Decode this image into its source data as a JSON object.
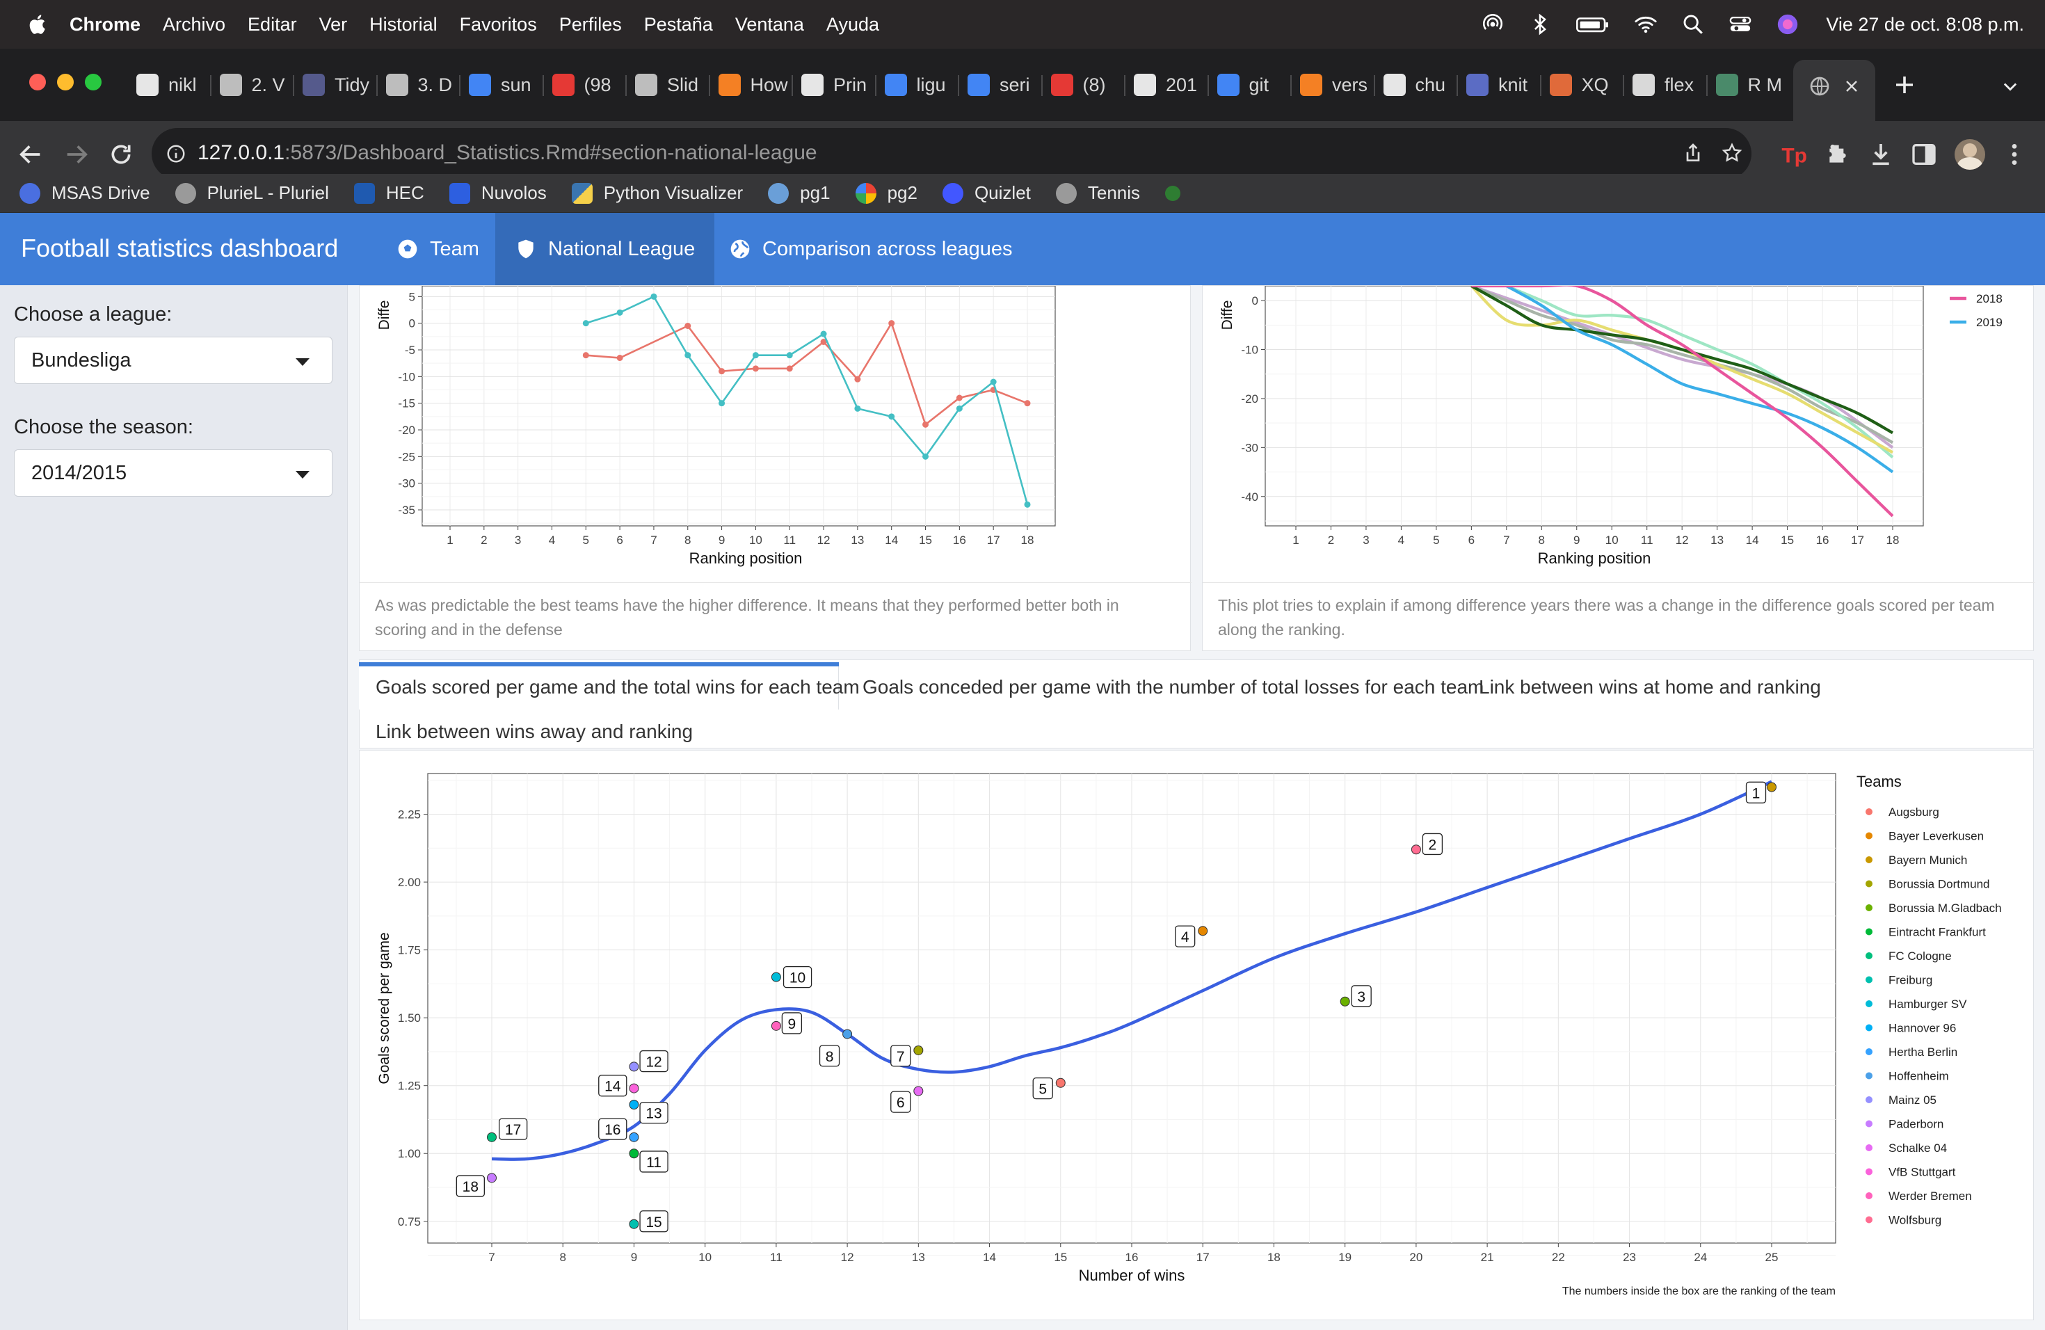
{
  "menubar": {
    "app": "Chrome",
    "items": [
      "Archivo",
      "Editar",
      "Ver",
      "Historial",
      "Favoritos",
      "Perfiles",
      "Pestaña",
      "Ventana",
      "Ayuda"
    ],
    "clock": "Vie 27 de oct.  8:08 p.m."
  },
  "tabs": [
    {
      "label": "nikl",
      "color": "#e6e6e6"
    },
    {
      "label": "2. V",
      "color": "#bdbdbd"
    },
    {
      "label": "Tidy",
      "color": "#555a8c"
    },
    {
      "label": "3. D",
      "color": "#bdbdbd"
    },
    {
      "label": "sun",
      "color": "#4285f4"
    },
    {
      "label": "(98",
      "color": "#e53935"
    },
    {
      "label": "Slid",
      "color": "#bdbdbd"
    },
    {
      "label": "How",
      "color": "#f48024"
    },
    {
      "label": "Prin",
      "color": "#e6e6e6"
    },
    {
      "label": "ligu",
      "color": "#4285f4"
    },
    {
      "label": "seri",
      "color": "#4285f4"
    },
    {
      "label": "(8)",
      "color": "#e53935"
    },
    {
      "label": "201",
      "color": "#e6e6e6"
    },
    {
      "label": "git",
      "color": "#4285f4"
    },
    {
      "label": "vers",
      "color": "#f48024"
    },
    {
      "label": "chu",
      "color": "#e6e6e6"
    },
    {
      "label": "knit",
      "color": "#5b6cc4"
    },
    {
      "label": "XQ",
      "color": "#e06a3a"
    },
    {
      "label": "flex",
      "color": "#d9d9d9"
    },
    {
      "label": "R M",
      "color": "#4a8a6a"
    }
  ],
  "address": {
    "host": "127.0.0.1",
    "path": ":5873/Dashboard_Statistics.Rmd#section-national-league"
  },
  "bookmarks": [
    "MSAS Drive",
    "PlurieL - Pluriel",
    "HEC",
    "Nuvolos",
    "Python Visualizer",
    "pg1",
    "pg2",
    "Quizlet",
    "Tennis"
  ],
  "app": {
    "brand": "Football statistics dashboard",
    "nav": [
      "Team",
      "National League",
      "Comparison across leagues"
    ]
  },
  "sidebar": {
    "league_label": "Choose a league:",
    "league_value": "Bundesliga",
    "season_label": "Choose the season:",
    "season_value": "2014/2015"
  },
  "panels": {
    "left_caption": "As was predictable the best teams have the higher difference. It means that they performed better both in scoring and in the defense",
    "right_caption": "This plot tries to explain if among difference years there was a change in the difference goals scored per team along the ranking."
  },
  "tabset": [
    "Goals scored per game and the total wins for each team",
    "Goals conceded per game with the number of total losses for each team",
    "Link between wins at home and ranking",
    "Link between wins away and ranking"
  ],
  "chart_data": [
    {
      "type": "line",
      "xlabel": "Ranking position",
      "ylabel": "Diffe",
      "x": [
        1,
        2,
        3,
        4,
        5,
        6,
        7,
        8,
        9,
        10,
        11,
        12,
        13,
        14,
        15,
        16,
        17,
        18
      ],
      "yticks": [
        5,
        0,
        -5,
        -10,
        -15,
        -20,
        -25,
        -30,
        -35
      ],
      "ylim": [
        -38,
        7
      ],
      "colors": [
        "#e8756b",
        "#44bfc4"
      ],
      "series": [
        {
          "name": "",
          "points": [
            [
              5,
              -6
            ],
            [
              6,
              -6.5
            ],
            [
              8,
              -0.5
            ],
            [
              9,
              -9
            ],
            [
              10,
              -8.5
            ],
            [
              11,
              -8.5
            ],
            [
              12,
              -3.5
            ],
            [
              13,
              -10.5
            ],
            [
              14,
              0
            ],
            [
              15,
              -19
            ],
            [
              16,
              -14
            ],
            [
              17,
              -12.5
            ],
            [
              18,
              -15
            ]
          ]
        },
        {
          "name": "",
          "points": [
            [
              5,
              0
            ],
            [
              6,
              2
            ],
            [
              7,
              5
            ],
            [
              8,
              -6
            ],
            [
              9,
              -15
            ],
            [
              10,
              -6
            ],
            [
              11,
              -6
            ],
            [
              12,
              -2
            ],
            [
              13,
              -16
            ],
            [
              14,
              -17.5
            ],
            [
              15,
              -25
            ],
            [
              16,
              -16
            ],
            [
              17,
              -11
            ],
            [
              18,
              -34
            ]
          ]
        }
      ]
    },
    {
      "type": "line",
      "xlabel": "Ranking position",
      "ylabel": "Diffe",
      "x": [
        1,
        2,
        3,
        4,
        5,
        6,
        7,
        8,
        9,
        10,
        11,
        12,
        13,
        14,
        15,
        16,
        17,
        18
      ],
      "yticks": [
        0,
        -10,
        -20,
        -30,
        -40
      ],
      "ylim": [
        -46,
        3
      ],
      "legend": [
        {
          "name": "2018",
          "color": "#e8559c"
        },
        {
          "name": "2019",
          "color": "#3aaee8"
        }
      ],
      "series": [
        {
          "color": "#e8559c",
          "points": [
            [
              6,
              3
            ],
            [
              8,
              3
            ],
            [
              9,
              3
            ],
            [
              10,
              0
            ],
            [
              11,
              -5
            ],
            [
              12,
              -9
            ],
            [
              13,
              -14
            ],
            [
              14,
              -19
            ],
            [
              15,
              -24
            ],
            [
              16,
              -30
            ],
            [
              17,
              -37
            ],
            [
              18,
              -44
            ]
          ]
        },
        {
          "color": "#3aaee8",
          "points": [
            [
              7,
              3
            ],
            [
              8,
              -1
            ],
            [
              9,
              -6
            ],
            [
              10,
              -9
            ],
            [
              11,
              -13
            ],
            [
              12,
              -17
            ],
            [
              13,
              -19
            ],
            [
              14,
              -21
            ],
            [
              15,
              -23
            ],
            [
              16,
              -26
            ],
            [
              17,
              -30
            ],
            [
              18,
              -35
            ]
          ]
        },
        {
          "color": "#1f5e16",
          "points": [
            [
              6,
              3
            ],
            [
              7,
              -1
            ],
            [
              8,
              -5
            ],
            [
              9,
              -6
            ],
            [
              10,
              -7
            ],
            [
              11,
              -8
            ],
            [
              12,
              -10
            ],
            [
              13,
              -12
            ],
            [
              14,
              -14
            ],
            [
              15,
              -17
            ],
            [
              16,
              -20
            ],
            [
              17,
              -23
            ],
            [
              18,
              -27
            ]
          ]
        },
        {
          "color": "#e6dd70",
          "points": [
            [
              6,
              3
            ],
            [
              7,
              -4
            ],
            [
              8,
              -5
            ],
            [
              9,
              -4
            ],
            [
              10,
              -6
            ],
            [
              11,
              -8
            ],
            [
              12,
              -10
            ],
            [
              13,
              -13
            ],
            [
              14,
              -16
            ],
            [
              15,
              -19
            ],
            [
              16,
              -23
            ],
            [
              17,
              -27
            ],
            [
              18,
              -31
            ]
          ]
        },
        {
          "color": "#9ee6c4",
          "points": [
            [
              7,
              3
            ],
            [
              8,
              0
            ],
            [
              9,
              -3
            ],
            [
              10,
              -3
            ],
            [
              11,
              -4
            ],
            [
              12,
              -7
            ],
            [
              13,
              -10
            ],
            [
              14,
              -13
            ],
            [
              15,
              -17
            ],
            [
              16,
              -21
            ],
            [
              17,
              -26
            ],
            [
              18,
              -32
            ]
          ]
        },
        {
          "color": "#a8b4a8",
          "points": [
            [
              6,
              3
            ],
            [
              7,
              0
            ],
            [
              8,
              -3
            ],
            [
              9,
              -5
            ],
            [
              10,
              -8
            ],
            [
              11,
              -9
            ],
            [
              12,
              -11
            ],
            [
              13,
              -13
            ],
            [
              14,
              -15
            ],
            [
              15,
              -18
            ],
            [
              16,
              -22
            ],
            [
              17,
              -25
            ],
            [
              18,
              -29
            ]
          ]
        },
        {
          "color": "#c8a8d0",
          "points": [
            [
              6,
              3
            ],
            [
              8,
              -2
            ],
            [
              10,
              -7
            ],
            [
              12,
              -12
            ],
            [
              14,
              -15
            ],
            [
              16,
              -20
            ],
            [
              18,
              -30
            ]
          ]
        }
      ]
    },
    {
      "type": "scatter",
      "xlabel": "Number of wins",
      "ylabel": "Goals scored per game",
      "xlim": [
        6.1,
        25.9
      ],
      "ylim": [
        0.67,
        2.4
      ],
      "xticks": [
        7,
        8,
        9,
        10,
        11,
        12,
        13,
        14,
        15,
        16,
        17,
        18,
        19,
        20,
        21,
        22,
        23,
        24,
        25
      ],
      "yticks": [
        0.75,
        1.0,
        1.25,
        1.5,
        1.75,
        2.0,
        2.25
      ],
      "legend_title": "Teams",
      "note": "The numbers inside the box are the ranking of the team",
      "teams": [
        {
          "name": "Augsburg",
          "color": "#f8766d",
          "wins": 15,
          "gpg": 1.26,
          "rank": 5,
          "lab": [
            -0.25,
            -0.02
          ]
        },
        {
          "name": "Bayer Leverkusen",
          "color": "#e58700",
          "wins": 17,
          "gpg": 1.82,
          "rank": 4,
          "lab": [
            -0.25,
            -0.02
          ]
        },
        {
          "name": "Bayern Munich",
          "color": "#c99800",
          "wins": 25,
          "gpg": 2.35,
          "rank": 1,
          "lab": [
            -0.22,
            -0.02
          ]
        },
        {
          "name": "Borussia Dortmund",
          "color": "#a3a500",
          "wins": 13,
          "gpg": 1.38,
          "rank": 7,
          "lab": [
            -0.25,
            -0.02
          ]
        },
        {
          "name": "Borussia M.Gladbach",
          "color": "#6bb100",
          "wins": 19,
          "gpg": 1.56,
          "rank": 3,
          "lab": [
            0.23,
            0.02
          ]
        },
        {
          "name": "Eintracht Frankfurt",
          "color": "#00ba38",
          "wins": 9,
          "gpg": 1.0,
          "rank": 11,
          "lab": [
            0.28,
            -0.03
          ]
        },
        {
          "name": "FC Cologne",
          "color": "#00bf7d",
          "wins": 7,
          "gpg": 1.06,
          "rank": 17,
          "lab": [
            0.3,
            0.03
          ]
        },
        {
          "name": "Freiburg",
          "color": "#00c0af",
          "wins": 9,
          "gpg": 0.74,
          "rank": 15,
          "lab": [
            0.28,
            0.01
          ]
        },
        {
          "name": "Hamburger SV",
          "color": "#00bcd8",
          "wins": 11,
          "gpg": 1.65,
          "rank": 10,
          "lab": [
            0.3,
            0.0
          ]
        },
        {
          "name": "Hannover 96",
          "color": "#00b0f6",
          "wins": 9,
          "gpg": 1.18,
          "rank": 13,
          "lab": [
            0.28,
            -0.03
          ]
        },
        {
          "name": "Hertha Berlin",
          "color": "#35a2ff",
          "wins": 9,
          "gpg": 1.06,
          "rank": 16,
          "lab": [
            -0.3,
            0.03
          ]
        },
        {
          "name": "Hoffenheim",
          "color": "#4ba0e8",
          "wins": 12,
          "gpg": 1.44,
          "rank": 8,
          "lab": [
            -0.25,
            -0.08
          ]
        },
        {
          "name": "Mainz 05",
          "color": "#9590ff",
          "wins": 9,
          "gpg": 1.32,
          "rank": 12,
          "lab": [
            0.28,
            0.02
          ]
        },
        {
          "name": "Paderborn",
          "color": "#c77cff",
          "wins": 7,
          "gpg": 0.91,
          "rank": 18,
          "lab": [
            -0.3,
            -0.03
          ]
        },
        {
          "name": "Schalke 04",
          "color": "#e76bf3",
          "wins": 13,
          "gpg": 1.23,
          "rank": 6,
          "lab": [
            -0.25,
            -0.04
          ]
        },
        {
          "name": "VfB Stuttgart",
          "color": "#fa62db",
          "wins": 9,
          "gpg": 1.24,
          "rank": 14,
          "lab": [
            -0.3,
            0.01
          ]
        },
        {
          "name": "Werder Bremen",
          "color": "#ff62bc",
          "wins": 11,
          "gpg": 1.47,
          "rank": 9,
          "lab": [
            0.22,
            0.01
          ]
        },
        {
          "name": "Wolfsburg",
          "color": "#ff6c91",
          "wins": 20,
          "gpg": 2.12,
          "rank": 2,
          "lab": [
            0.23,
            0.02
          ]
        }
      ],
      "smooth": [
        [
          7,
          0.98
        ],
        [
          7.5,
          0.98
        ],
        [
          8,
          1.0
        ],
        [
          8.5,
          1.04
        ],
        [
          9,
          1.1
        ],
        [
          9.5,
          1.22
        ],
        [
          10,
          1.38
        ],
        [
          10.5,
          1.49
        ],
        [
          11,
          1.53
        ],
        [
          11.5,
          1.52
        ],
        [
          12,
          1.44
        ],
        [
          12.5,
          1.35
        ],
        [
          13,
          1.31
        ],
        [
          13.5,
          1.3
        ],
        [
          14,
          1.32
        ],
        [
          14.5,
          1.36
        ],
        [
          15,
          1.39
        ],
        [
          15.5,
          1.43
        ],
        [
          16,
          1.48
        ],
        [
          17,
          1.6
        ],
        [
          18,
          1.72
        ],
        [
          19,
          1.81
        ],
        [
          20,
          1.89
        ],
        [
          21,
          1.98
        ],
        [
          22,
          2.07
        ],
        [
          23,
          2.16
        ],
        [
          24,
          2.25
        ],
        [
          25,
          2.37
        ]
      ]
    }
  ]
}
